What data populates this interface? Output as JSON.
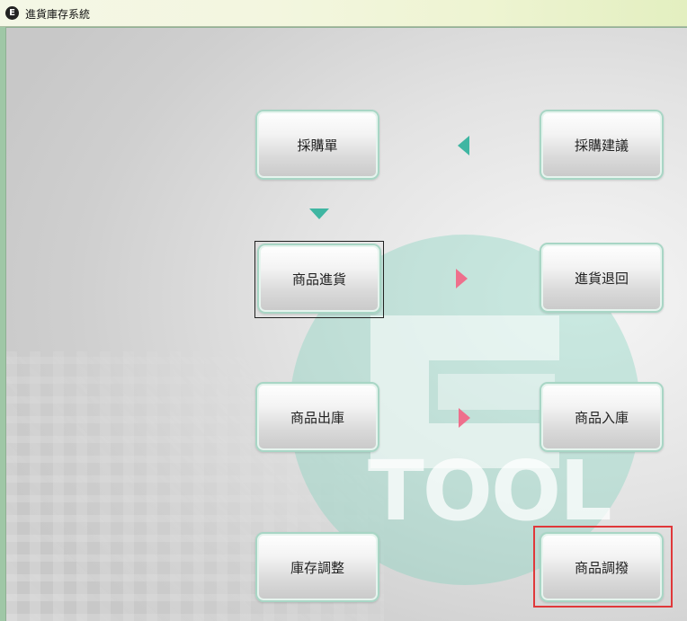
{
  "window": {
    "title": "進貨庫存系統",
    "app_icon": "ez-logo-icon"
  },
  "watermark": {
    "text": "TOOL",
    "logo": "ez-tool-logo"
  },
  "buttons": {
    "purchase_order": "採購單",
    "purchase_suggestion": "採購建議",
    "goods_receipt": "商品進貨",
    "purchase_return": "進貨退回",
    "goods_issue": "商品出庫",
    "goods_stock_in": "商品入庫",
    "stock_adjustment": "庫存調整",
    "goods_transfer": "商品調撥"
  },
  "colors": {
    "accent_teal": "#3fb6a2",
    "accent_pink": "#ee6f8c",
    "highlight_red": "#e0383a",
    "button_border": "#a8d6c5"
  }
}
